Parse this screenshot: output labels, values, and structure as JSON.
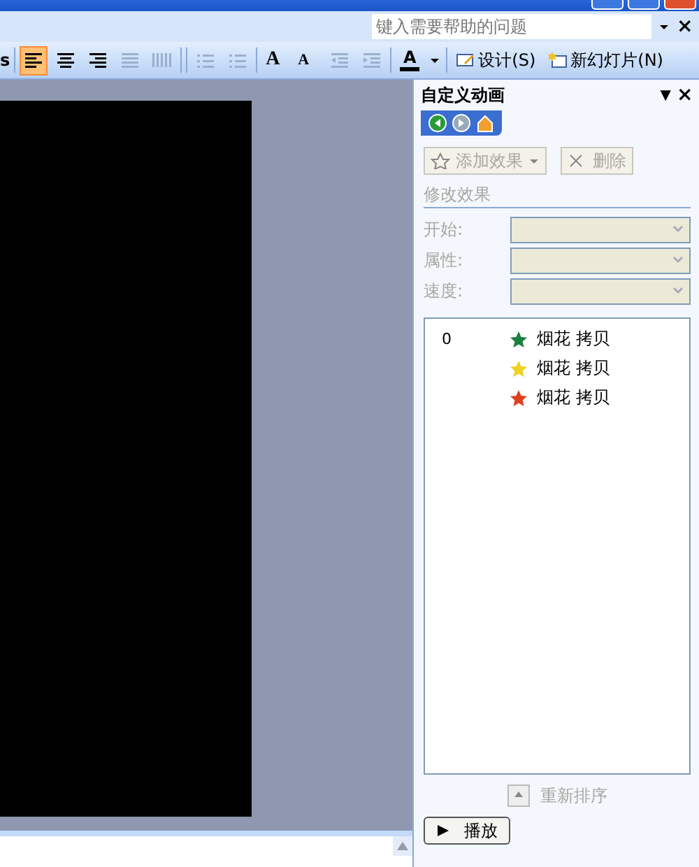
{
  "help": {
    "placeholder": "键入需要帮助的问题",
    "close": "×"
  },
  "toolbar": {
    "items": [
      {
        "kind": "text",
        "label": "s"
      },
      {
        "kind": "align-left",
        "selected": true
      },
      {
        "kind": "align-center",
        "selected": false
      },
      {
        "kind": "align-right",
        "selected": false
      },
      {
        "kind": "justify",
        "selected": false,
        "disabled": true
      },
      {
        "kind": "distribute",
        "selected": false,
        "disabled": true
      },
      {
        "kind": "numbered-list",
        "selected": false,
        "disabled": true
      },
      {
        "kind": "bullet-list",
        "selected": false,
        "disabled": true
      },
      {
        "kind": "grow-font",
        "label": "A"
      },
      {
        "kind": "shrink-font",
        "label": "A"
      },
      {
        "kind": "outdent",
        "selected": false,
        "disabled": true
      },
      {
        "kind": "indent",
        "selected": false,
        "disabled": true
      },
      {
        "kind": "font-color",
        "label": "A"
      },
      {
        "kind": "design",
        "label": "设计(S)"
      },
      {
        "kind": "new-slide",
        "label": "新幻灯片(N)"
      }
    ]
  },
  "task_pane": {
    "title": "自定义动画",
    "menu": "▼",
    "close": "×",
    "nav": [
      {
        "kind": "back",
        "disabled": false
      },
      {
        "kind": "forward",
        "disabled": true
      },
      {
        "kind": "home",
        "disabled": false
      }
    ],
    "add_effect": {
      "label": "添加效果",
      "disabled": true
    },
    "remove": {
      "label": "删除",
      "disabled": true
    },
    "section": {
      "label": "修改效果",
      "disabled": true
    },
    "fields": [
      {
        "label": "开始:",
        "disabled": true
      },
      {
        "label": "属性:",
        "disabled": true
      },
      {
        "label": "速度:",
        "disabled": true
      }
    ],
    "effects": [
      {
        "number": "0",
        "color": "#1a8040",
        "label": "烟花 拷贝"
      },
      {
        "color": "#f0d020",
        "label": "烟花 拷贝"
      },
      {
        "color": "#e04020",
        "label": "烟花 拷贝"
      }
    ],
    "reorder": {
      "label": "重新排序",
      "disabled": true
    },
    "play": {
      "label": "播放"
    }
  }
}
